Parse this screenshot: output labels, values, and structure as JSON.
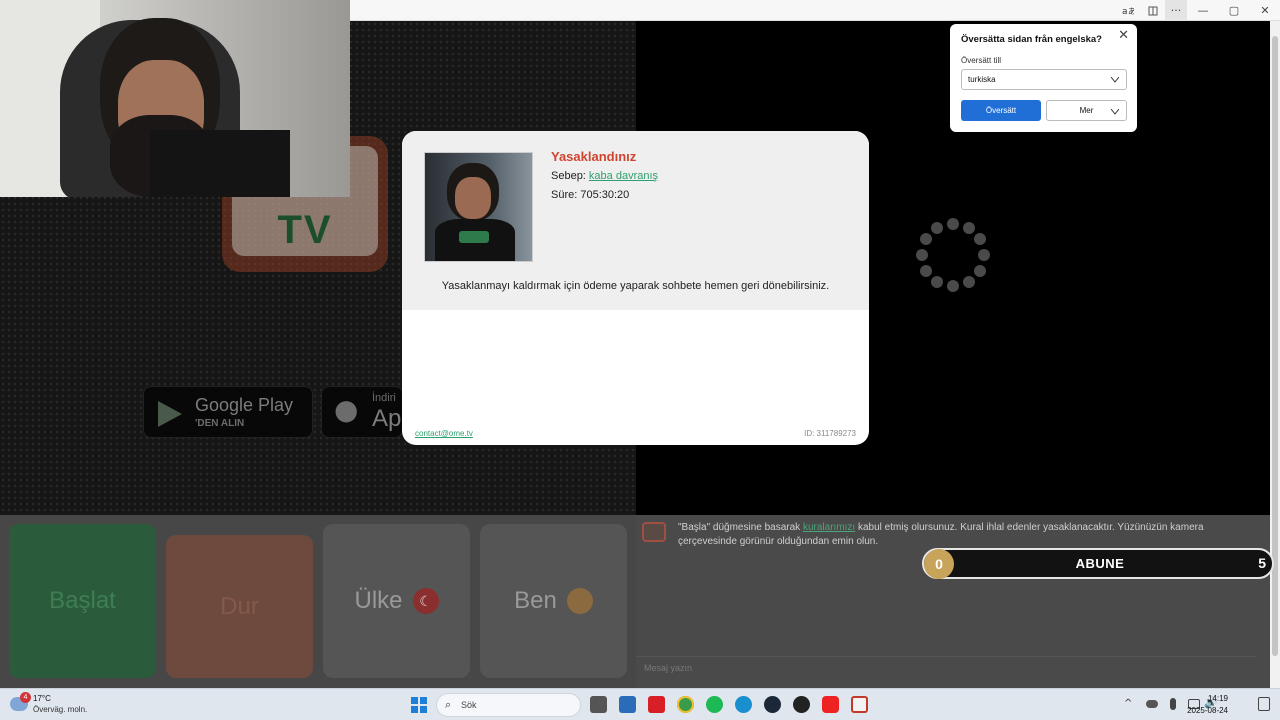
{
  "browser": {
    "more_label": "···",
    "window_controls": [
      "—",
      "▢",
      "✕"
    ]
  },
  "logo": {
    "text": "TV"
  },
  "stores": {
    "google_title": "Google Play",
    "google_sub": "'DEN ALIN",
    "apple_title": "Ap",
    "apple_sub": "İndiri"
  },
  "ban_modal": {
    "title": "Yasaklandınız",
    "reason_label": "Sebep: ",
    "reason_value": "kaba davranış",
    "duration": "Süre: 705:30:20",
    "pay_message": "Yasaklanmayı kaldırmak için ödeme yaparak sohbete hemen geri dönebilirsiniz.",
    "contact": "contact@ome.tv",
    "id": "ID: 311789273"
  },
  "translate_popup": {
    "title": "Översätta sidan från engelska?",
    "to_label": "Översätt till",
    "language": "turkiska",
    "translate_button": "Översätt",
    "more_button": "Mer"
  },
  "controls": {
    "start": "Başlat",
    "stop": "Dur",
    "country": "Ülke",
    "me": "Ben"
  },
  "chat": {
    "notice_pre": "\"Başla\" düğmesine basarak ",
    "notice_link": "kuralarımızı",
    "notice_post": " kabul etmiş olursunuz. Kural ihlal edenler yasaklanacaktır. Yüzünüzün kamera çerçevesinde görünür olduğundan emin olun.",
    "input_placeholder": "Mesaj yazın"
  },
  "abune": {
    "label": "ABUNE",
    "left_count": "0",
    "right_count": "5"
  },
  "taskbar": {
    "weather_badge": "4",
    "temperature": "17°C",
    "weather_desc": "Överväg. moln.",
    "search_label": "Sök",
    "time": "14:19",
    "date": "2025-08-24"
  }
}
